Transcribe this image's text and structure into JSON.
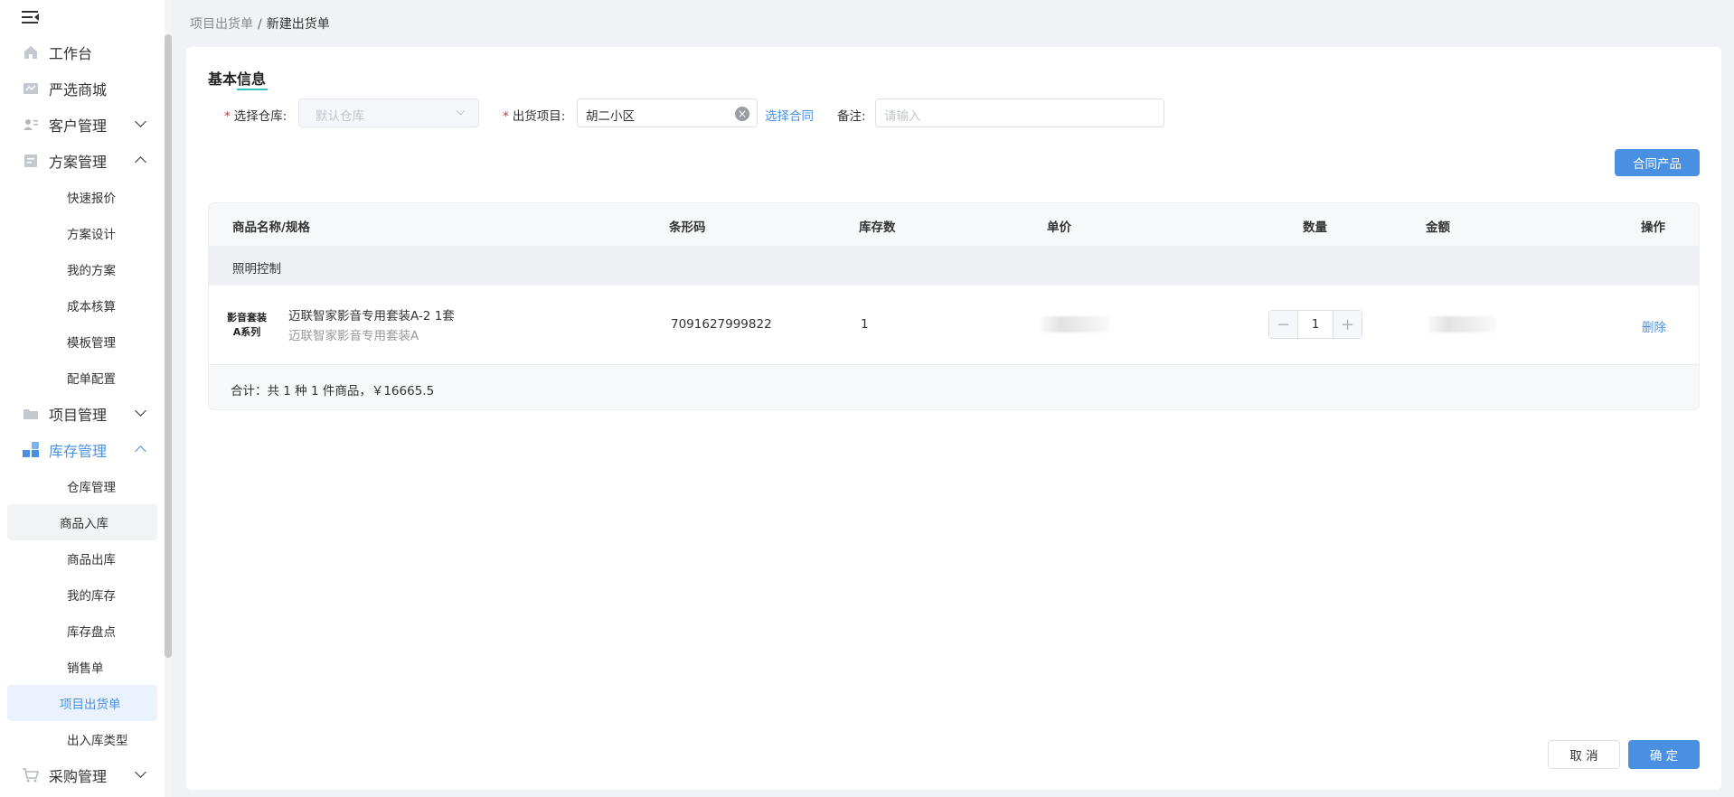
{
  "sidebar": {
    "items": [
      {
        "label": "工作台"
      },
      {
        "label": "严选商城"
      },
      {
        "label": "客户管理"
      },
      {
        "label": "方案管理"
      },
      {
        "label": "项目管理"
      },
      {
        "label": "库存管理"
      },
      {
        "label": "采购管理"
      }
    ],
    "scheme_sub": [
      "快速报价",
      "方案设计",
      "我的方案",
      "成本核算",
      "模板管理",
      "配单配置"
    ],
    "inventory_sub": [
      "仓库管理",
      "商品入库",
      "商品出库",
      "我的库存",
      "库存盘点",
      "销售单",
      "项目出货单",
      "出入库类型"
    ]
  },
  "breadcrumb": {
    "parent": "项目出货单",
    "sep": "/",
    "current": "新建出货单"
  },
  "form": {
    "section_title": "基本信息",
    "required_mark": "*",
    "warehouse_label": "选择仓库:",
    "warehouse_value": "默认仓库",
    "project_label": "出货项目:",
    "project_value": "胡二小区",
    "clear_glyph": "×",
    "select_contract": "选择合同",
    "remark_label": "备注:",
    "remark_placeholder": "请输入"
  },
  "buttons": {
    "contract_products": "合同产品",
    "cancel": "取 消",
    "confirm": "确 定"
  },
  "table": {
    "columns": [
      "商品名称/规格",
      "条形码",
      "库存数",
      "单价",
      "数量",
      "金额",
      "操作"
    ],
    "group": "照明控制",
    "row": {
      "thumb_line1": "影音套装",
      "thumb_line2": "A系列",
      "name": "迈联智家影音专用套装A-2 1套",
      "spec": "迈联智家影音专用套装A",
      "barcode": "7091627999822",
      "stock": "1",
      "quantity": "1",
      "minus": "−",
      "plus": "+",
      "action": "删除"
    },
    "summary": "合计：共 1 种 1 件商品，￥16665.5"
  },
  "colors": {
    "primary": "#4a90e2",
    "danger": "#f5222d"
  }
}
